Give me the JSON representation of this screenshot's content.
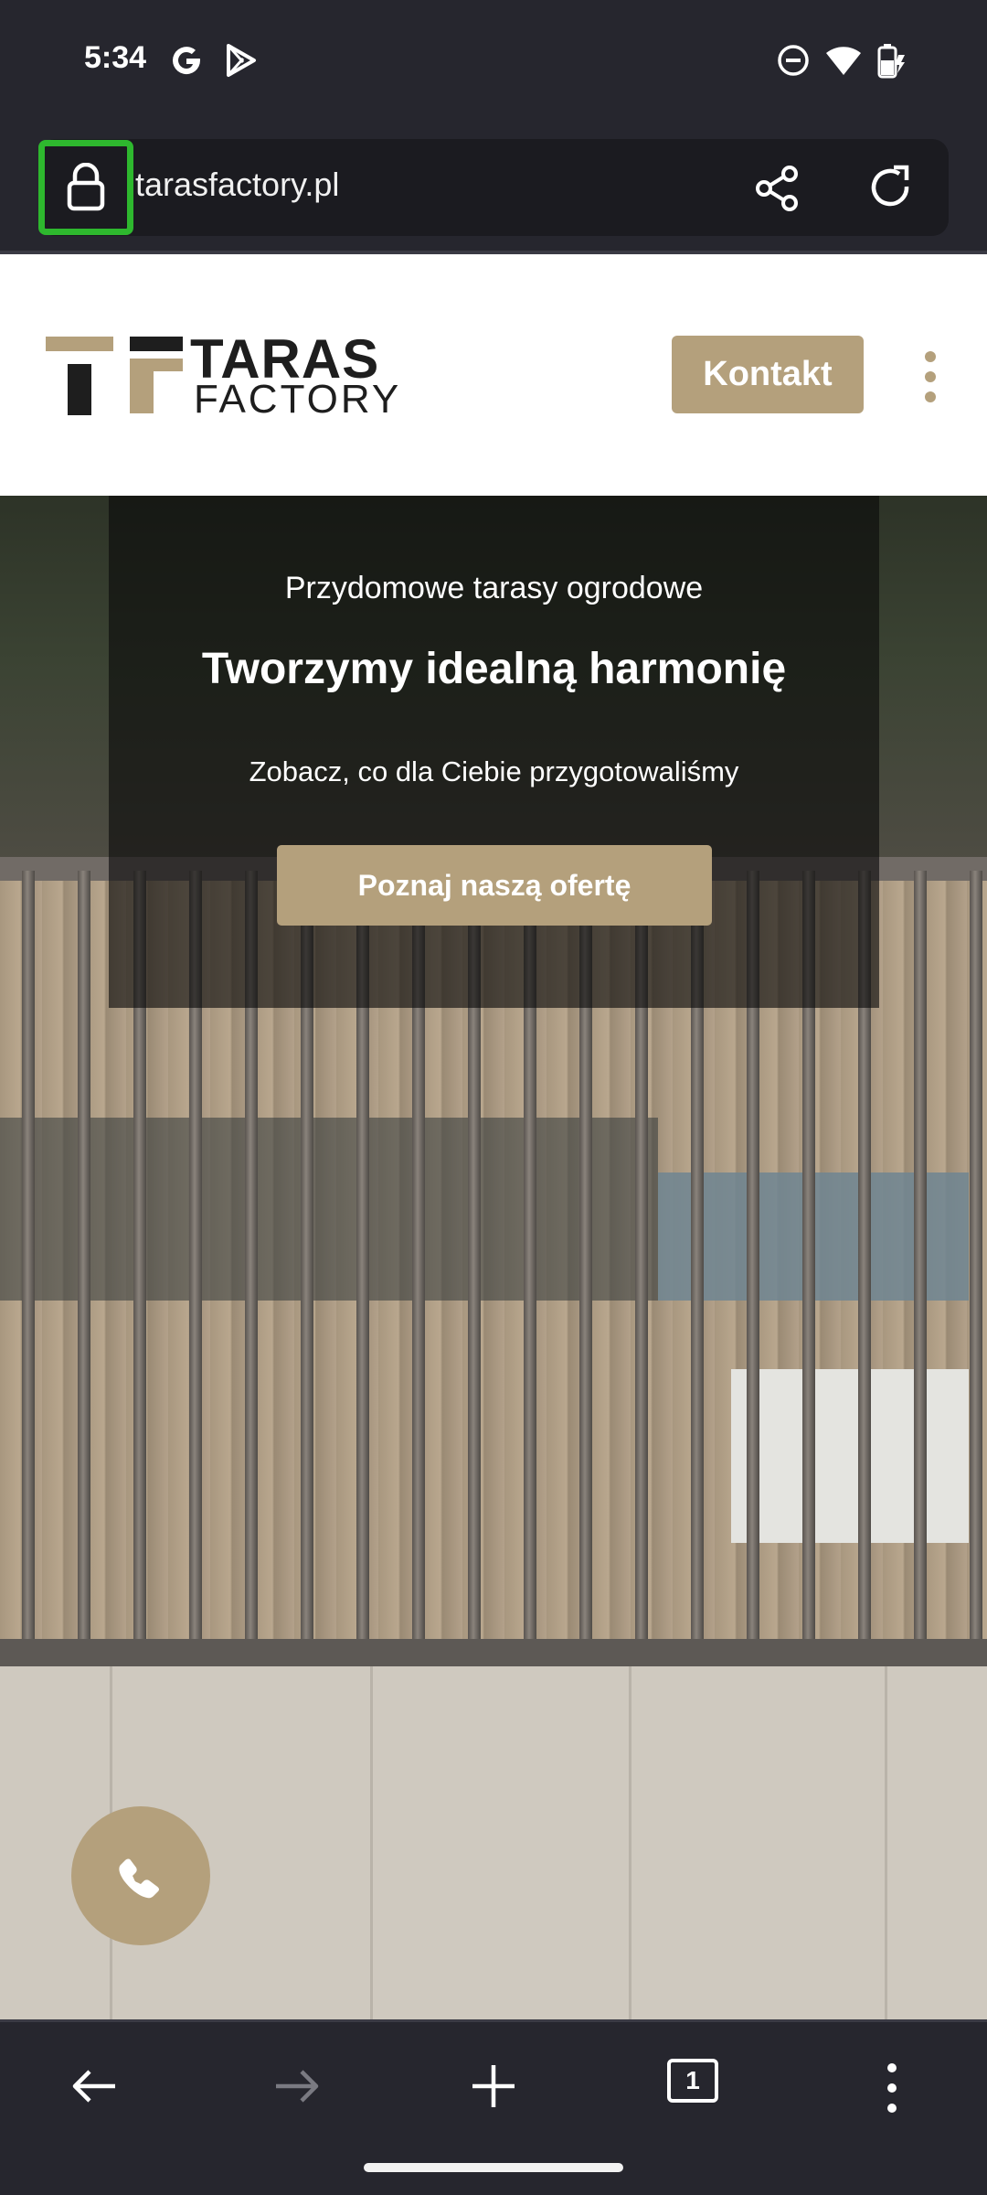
{
  "status_bar": {
    "time": "5:34",
    "left_icons": [
      "google-icon",
      "play-store-icon"
    ],
    "right_icons": [
      "do-not-disturb-icon",
      "wifi-icon",
      "battery-charging-icon"
    ]
  },
  "browser": {
    "url": "tarasfactory.pl",
    "icons": [
      "lock-icon",
      "share-icon",
      "reload-icon"
    ],
    "bottom_nav": [
      "back-arrow-icon",
      "forward-arrow-icon",
      "new-tab-icon",
      "tab-count-icon",
      "more-menu-icon"
    ],
    "tab_count": "1"
  },
  "site": {
    "logo_line1": "TARAS",
    "logo_line2": "FACTORY",
    "contact_button": "Kontakt",
    "hero": {
      "kicker": "Przydomowe tarasy ogrodowe",
      "title": "Tworzymy idealną harmonię",
      "subtitle": "Zobacz, co dla Ciebie przygotowaliśmy",
      "cta": "Poznaj naszą ofertę"
    }
  },
  "colors": {
    "accent": "#b4a07c",
    "highlight": "#2eb82e",
    "chrome": "#26262e"
  }
}
